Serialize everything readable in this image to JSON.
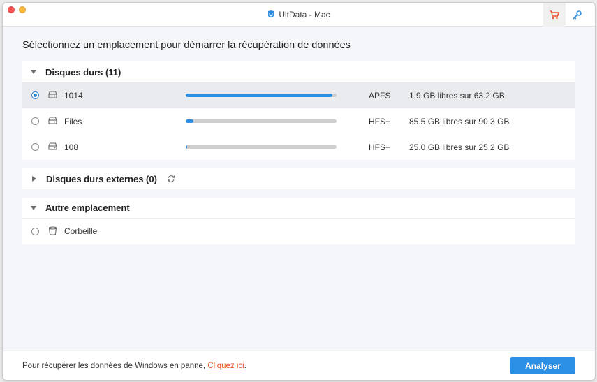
{
  "window": {
    "title": "UltData - Mac",
    "accent_color": "#2f8ee0",
    "link_color": "#e8542c"
  },
  "header": {
    "heading": "Sélectionnez un emplacement pour démarrer la récupération de données"
  },
  "hard_drives": {
    "title": "Disques durs (11)",
    "items": [
      {
        "name": "1014",
        "fs": "APFS",
        "space": "1.9 GB libres sur 63.2 GB",
        "used_fraction": 0.97,
        "selected": true
      },
      {
        "name": "Files",
        "fs": "HFS+",
        "space": "85.5 GB libres sur 90.3 GB",
        "used_fraction": 0.053,
        "selected": false
      },
      {
        "name": "108",
        "fs": "HFS+",
        "space": "25.0 GB libres sur 25.2 GB",
        "used_fraction": 0.008,
        "selected": false
      }
    ]
  },
  "external_drives": {
    "title": "Disques durs externes (0)"
  },
  "other_location": {
    "title": "Autre emplacement",
    "items": [
      {
        "name": "Corbeille"
      }
    ]
  },
  "footer": {
    "text": "Pour récupérer les données de Windows en panne, ",
    "link": "Cliquez ici",
    "suffix": ".",
    "analyze_label": "Analyser"
  }
}
